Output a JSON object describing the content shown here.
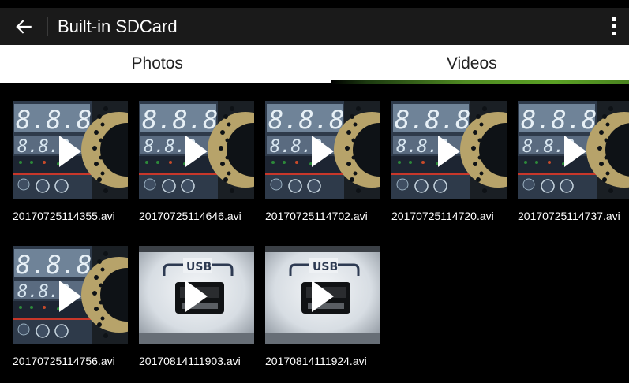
{
  "header": {
    "title": "Built-in SDCard",
    "back_icon": "arrow-left-icon",
    "overflow_icon": "more-vert-icon"
  },
  "tabs": [
    {
      "label": "Photos",
      "selected": false
    },
    {
      "label": "Videos",
      "selected": true
    }
  ],
  "accent_color": "#5aa024",
  "videos": [
    {
      "name": "20170725114355.avi",
      "thumb": "controller"
    },
    {
      "name": "20170725114646.avi",
      "thumb": "controller"
    },
    {
      "name": "20170725114702.avi",
      "thumb": "controller"
    },
    {
      "name": "20170725114720.avi",
      "thumb": "controller"
    },
    {
      "name": "20170725114737.avi",
      "thumb": "controller"
    },
    {
      "name": "20170725114756.avi",
      "thumb": "controller"
    },
    {
      "name": "20170814111903.avi",
      "thumb": "usb"
    },
    {
      "name": "20170814111924.avi",
      "thumb": "usb"
    }
  ]
}
